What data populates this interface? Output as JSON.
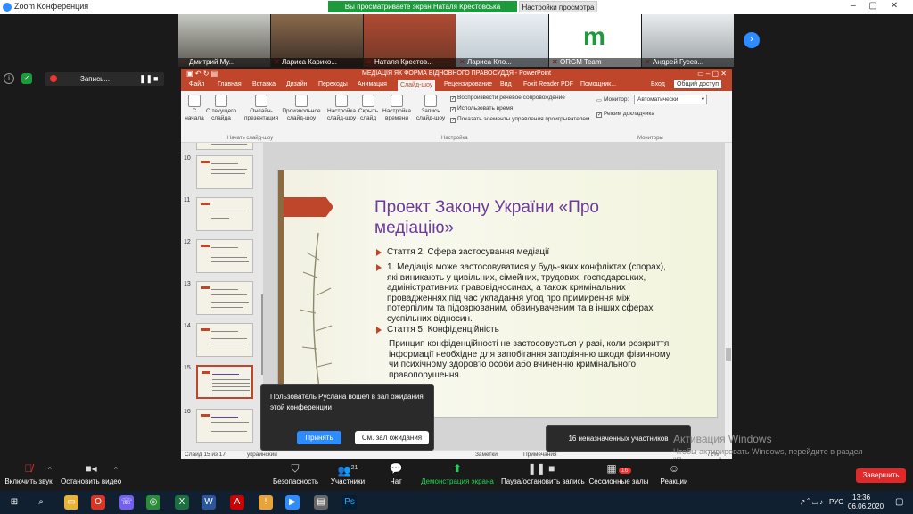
{
  "window": {
    "title": "Zoom Конференция",
    "banner": "Вы просматриваете экран Наталя Крестовська",
    "view_options": "Настройки просмотра"
  },
  "participants": [
    "Дмитрий Му...",
    "Лариса Карико...",
    "Наталя Крестов...",
    "Лариса Кло...",
    "ORGM Team",
    "Андрей Гусев..."
  ],
  "recording": {
    "label": "Запись..."
  },
  "ppt": {
    "title": "МЕДІАЦІЯ ЯК ФОРМА ВІДНОВНОГО ПРАВОСУДДЯ - PowerPoint",
    "tabs": [
      "Файл",
      "Главная",
      "Вставка",
      "Дизайн",
      "Переходы",
      "Анимация",
      "Слайд-шоу",
      "Рецензирование",
      "Вид",
      "Foxit Reader PDF",
      "Помощник...",
      "Вход",
      "Общий доступ"
    ],
    "ribbon": {
      "from_start": "С начала",
      "from_current": "С текущего слайда",
      "online": "Онлайн-презентация",
      "custom": "Произвольное слайд-шоу",
      "group_start": "Начать слайд-шоу",
      "setup": "Настройка слайд-шоу",
      "hide": "Скрыть слайд",
      "timing": "Настройка времени",
      "record": "Запись слайд-шоу",
      "group_setup": "Настройка",
      "chk_narration": "Воспроизвести речевое сопровождение",
      "chk_timing": "Использовать время",
      "chk_controls": "Показать элементы управления проигрывателем",
      "monitor_label": "Монитор:",
      "monitor_value": "Автоматически",
      "presenter": "Режим докладчика",
      "group_monitors": "Мониторы"
    },
    "slide_numbers": [
      "10",
      "11",
      "12",
      "13",
      "14",
      "15",
      "16"
    ],
    "slide": {
      "title": "Проект Закону України «Про медіацію»",
      "b1": "Стаття 2. Сфера застосування медіації",
      "b2": "1. Медіація може застосовуватися у будь-яких конфліктах (спорах), які виникають у цивільних, сімейних, трудових, господарських, адміністративних правовідносинах, а також кримінальних провадженнях під час укладання угод про примирення між потерпілим та підозрюваним, обвинуваченим та в інших сферах суспільних відносин.",
      "b3": "Стаття 5. Конфіденційність",
      "p": "Принцип конфіденційності не застосовується у разі, коли розкриття інформації необхідне для запобігання заподіянню шкоди фізичному чи психічному здоров'ю особи або вчиненню кримінального правопорушення."
    },
    "status": {
      "slide": "Слайд 15 из 17",
      "lang": "украинский",
      "notes": "Заметки",
      "comments": "Примечания",
      "zoom": "72%"
    }
  },
  "notify": {
    "text": "Пользователь Руслана вошел в зал ожидания этой конференции",
    "accept": "Принять",
    "waiting": "См. зал ожидания"
  },
  "unassigned": "16 неназначенных участников",
  "activate": {
    "title": "Активация Windows",
    "sub": "Чтобы активировать Windows, перейдите в раздел \"Параметры\"."
  },
  "toolbar": {
    "mute": "Включить звук",
    "video": "Остановить видео",
    "security": "Безопасность",
    "participants": "Участники",
    "participants_count": "21",
    "chat": "Чат",
    "share": "Демонстрация экрана",
    "pause": "Пауза/остановить запись",
    "breakout": "Сессионные залы",
    "breakout_count": "16",
    "reactions": "Реакции",
    "end": "Завершить"
  },
  "taskbar": {
    "lang": "РУС",
    "time": "13:36",
    "date": "06.06.2020"
  }
}
